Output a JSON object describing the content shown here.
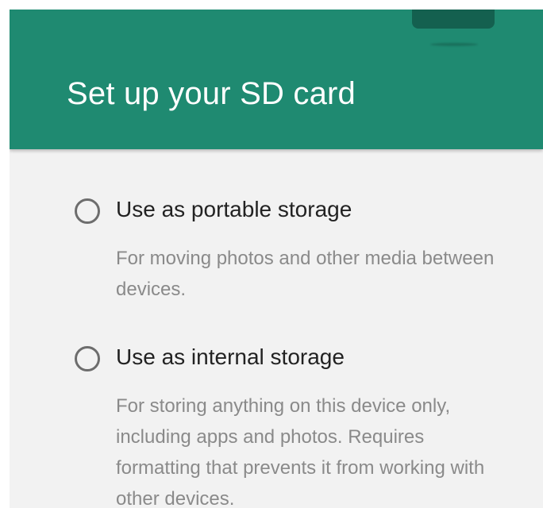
{
  "header": {
    "title": "Set up your SD card"
  },
  "options": [
    {
      "label": "Use as portable storage",
      "description": "For moving photos and other media between devices."
    },
    {
      "label": "Use as internal storage",
      "description": "For storing anything on this device only, including apps and photos. Requires formatting that prevents it from working with other devices."
    }
  ],
  "colors": {
    "header": "#1f8a71",
    "background": "#f2f2f2"
  },
  "icons": {
    "illustration": "sd-card-icon",
    "radio": "radio-unchecked-icon"
  }
}
